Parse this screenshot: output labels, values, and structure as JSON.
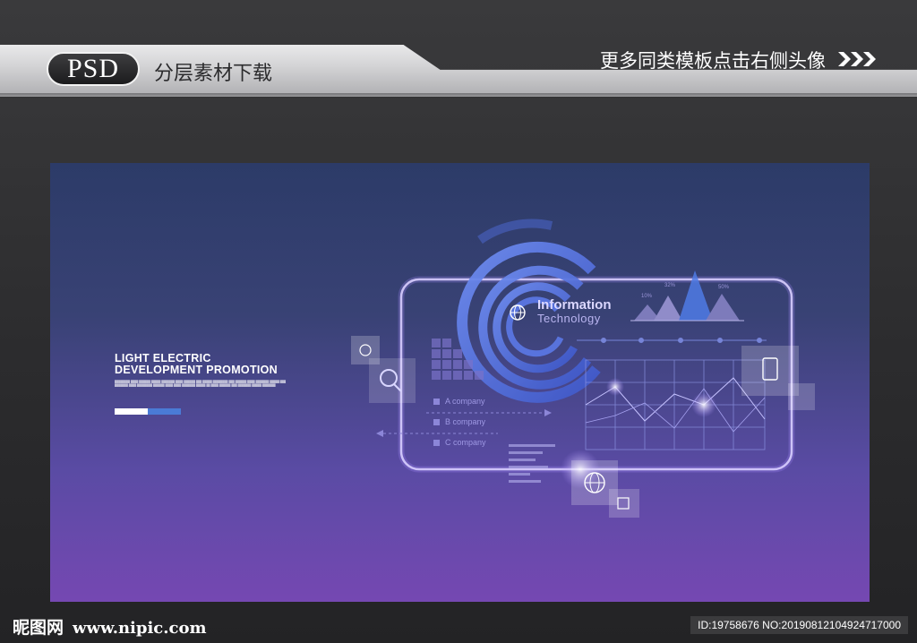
{
  "banner": {
    "badge": "PSD",
    "subtitle": "分层素材下载",
    "right_text": "更多同类模板点击右侧头像"
  },
  "poster": {
    "headline_line1": "LIGHT ELECTRIC",
    "headline_line2": "DEVELOPMENT PROMOTION",
    "info_title": "Information",
    "info_subtitle": "Technology",
    "companies": [
      "A company",
      "B company",
      "C company"
    ],
    "percent_labels": [
      "10%",
      "32%",
      "50%"
    ]
  },
  "footer": {
    "site_name": "昵图网",
    "site_url": "www.nipic.com",
    "id_text": "ID:19758676 NO:20190812104924717000"
  },
  "colors": {
    "artboard_top": "#2c3b68",
    "artboard_bottom": "#7548b2",
    "accent_blue": "#4a6bd6",
    "accent_purple": "#9b7bff"
  }
}
